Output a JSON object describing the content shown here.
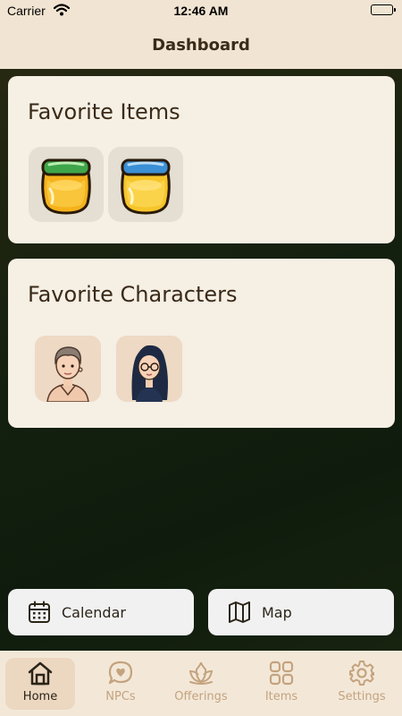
{
  "status_bar": {
    "carrier": "Carrier",
    "time": "12:46 AM"
  },
  "header": {
    "title": "Dashboard"
  },
  "favorite_items": {
    "title": "Favorite Items",
    "items": [
      {
        "icon": "jar-green-lid-icon"
      },
      {
        "icon": "jar-blue-lid-icon"
      }
    ]
  },
  "favorite_characters": {
    "title": "Favorite Characters",
    "characters": [
      {
        "icon": "man-avatar-icon"
      },
      {
        "icon": "woman-glasses-avatar-icon"
      }
    ]
  },
  "actions": {
    "calendar_label": "Calendar",
    "map_label": "Map"
  },
  "tabbar": {
    "tabs": [
      {
        "label": "Home",
        "icon": "house-icon",
        "active": true
      },
      {
        "label": "NPCs",
        "icon": "heart-bubble-icon",
        "active": false
      },
      {
        "label": "Offerings",
        "icon": "lotus-icon",
        "active": false
      },
      {
        "label": "Items",
        "icon": "grid-icon",
        "active": false
      },
      {
        "label": "Settings",
        "icon": "gear-icon",
        "active": false
      }
    ]
  },
  "colors": {
    "header_bg": "#f1e4d2",
    "card_bg": "#f5efe4",
    "accent": "#c4a37f",
    "text_dark": "#3a2a18"
  }
}
